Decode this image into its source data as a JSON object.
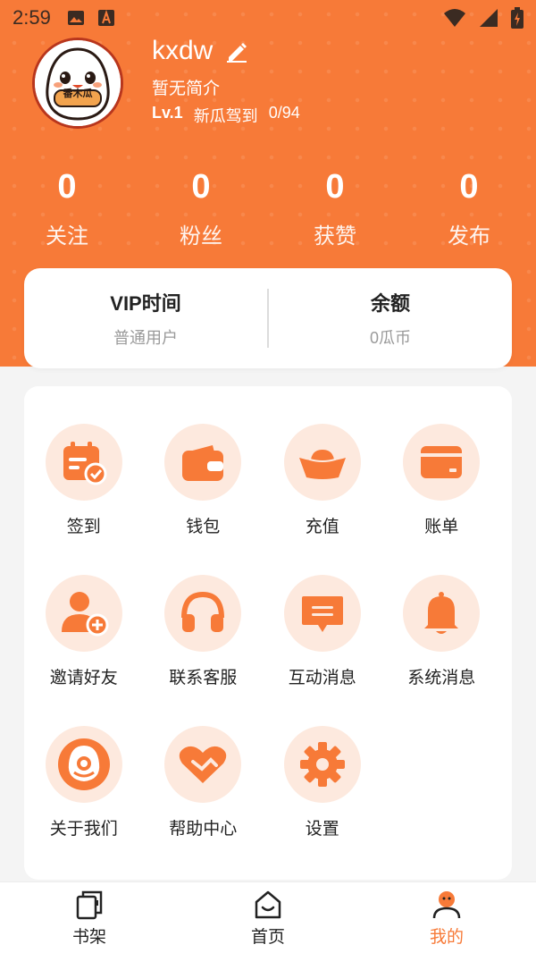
{
  "status_bar": {
    "time": "2:59"
  },
  "profile": {
    "avatar_text": "番木瓜",
    "username": "kxdw",
    "bio": "暂无简介",
    "level": "Lv.1",
    "level_title": "新瓜驾到",
    "progress": "0/94"
  },
  "stats": [
    {
      "value": "0",
      "label": "关注"
    },
    {
      "value": "0",
      "label": "粉丝"
    },
    {
      "value": "0",
      "label": "获赞"
    },
    {
      "value": "0",
      "label": "发布"
    }
  ],
  "vip": {
    "left_title": "VIP时间",
    "left_sub": "普通用户",
    "right_title": "余额",
    "right_sub": "0瓜币"
  },
  "grid": [
    {
      "label": "签到",
      "icon": "calendar-check-icon"
    },
    {
      "label": "钱包",
      "icon": "wallet-icon"
    },
    {
      "label": "充值",
      "icon": "gold-ingot-icon"
    },
    {
      "label": "账单",
      "icon": "card-icon"
    },
    {
      "label": "邀请好友",
      "icon": "add-user-icon"
    },
    {
      "label": "联系客服",
      "icon": "headphones-icon"
    },
    {
      "label": "互动消息",
      "icon": "message-icon"
    },
    {
      "label": "系统消息",
      "icon": "bell-icon"
    },
    {
      "label": "关于我们",
      "icon": "about-mascot-icon"
    },
    {
      "label": "帮助中心",
      "icon": "heart-handshake-icon"
    },
    {
      "label": "设置",
      "icon": "gear-icon"
    }
  ],
  "tabs": [
    {
      "label": "书架",
      "icon": "bookshelf-icon"
    },
    {
      "label": "首页",
      "icon": "home-icon"
    },
    {
      "label": "我的",
      "icon": "profile-icon",
      "active": true
    }
  ],
  "colors": {
    "accent": "#f77a38",
    "icon_bg": "#fde9de",
    "background": "#f4f4f4"
  }
}
